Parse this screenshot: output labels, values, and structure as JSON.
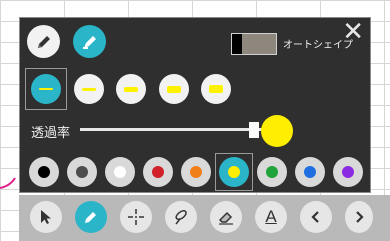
{
  "panel": {
    "close_glyph": "✕",
    "tools": [
      {
        "icon": "pen-icon",
        "active": false
      },
      {
        "icon": "highlighter-icon",
        "active": true
      }
    ],
    "autoshape": {
      "label": "オートシェイプ",
      "enabled": false
    },
    "widths": {
      "selected_index": 0,
      "count": 5
    },
    "opacity": {
      "label": "透過率",
      "value": 0.9
    },
    "preview_color": "#ffee00",
    "colors": [
      {
        "name": "black",
        "hex": "#000000"
      },
      {
        "name": "dark-gray",
        "hex": "#4d4d4d"
      },
      {
        "name": "white",
        "hex": "#ffffff"
      },
      {
        "name": "red",
        "hex": "#d0202a"
      },
      {
        "name": "orange",
        "hex": "#f07f1a"
      },
      {
        "name": "yellow",
        "hex": "#ffee00",
        "selected": true
      },
      {
        "name": "green",
        "hex": "#1fa33a"
      },
      {
        "name": "blue",
        "hex": "#1f6fe0"
      },
      {
        "name": "purple",
        "hex": "#8a2be2"
      }
    ]
  },
  "toolbar": {
    "accent": "#2bb5c8",
    "buttons": [
      {
        "icon": "cursor-icon"
      },
      {
        "icon": "pen-icon",
        "active": true
      },
      {
        "icon": "crosshair-icon"
      },
      {
        "icon": "lasso-icon"
      },
      {
        "icon": "eraser-icon"
      },
      {
        "icon": "text-icon",
        "glyph": "A"
      },
      {
        "icon": "chevron-left-icon"
      },
      {
        "icon": "chevron-right-icon"
      }
    ]
  }
}
